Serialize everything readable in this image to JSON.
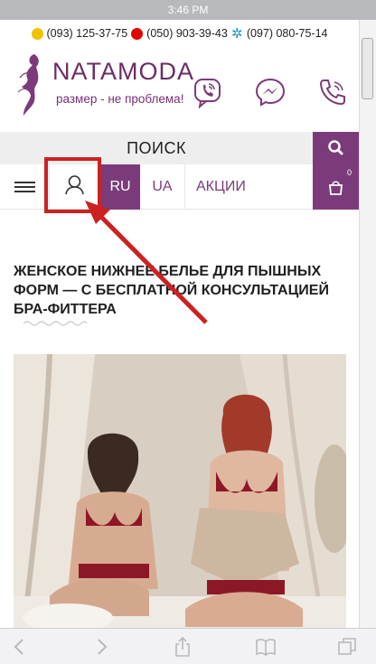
{
  "status_bar": {
    "time": "3:46 PM"
  },
  "contacts": {
    "phones": [
      {
        "operator_icon": "lifecell-icon",
        "number": "(093) 125-37-75"
      },
      {
        "operator_icon": "vodafone-icon",
        "number": "(050) 903-39-43"
      },
      {
        "operator_icon": "kyivstar-icon",
        "number": "(097) 080-75-14"
      }
    ]
  },
  "brand": {
    "name_part1": "NATA",
    "name_part2": "MODA",
    "tagline": "размер - не проблема!",
    "color": "#7b3b7a"
  },
  "header_icons": [
    "viber-icon",
    "messenger-icon",
    "phone-icon"
  ],
  "search": {
    "label": "ПОИСК",
    "button_icon": "search-icon"
  },
  "nav": {
    "menu_icon": "hamburger-icon",
    "account_icon": "user-icon",
    "lang_active": "RU",
    "lang_other": "UA",
    "promo": "АКЦИИ",
    "cart_icon": "cart-icon",
    "cart_count": "0"
  },
  "content": {
    "headline": "ЖЕНСКОЕ НИЖНЕЕ БЕЛЬЕ ДЛЯ ПЫШНЫХ ФОРМ — С БЕСПЛАТНОЙ КОНСУЛЬТАЦИЕЙ БРА-ФИТТЕРА"
  },
  "annotation": {
    "color": "#cc2121",
    "target": "user-icon"
  },
  "browser_toolbar": [
    "back-icon",
    "forward-icon",
    "share-icon",
    "bookmarks-icon",
    "tabs-icon"
  ]
}
